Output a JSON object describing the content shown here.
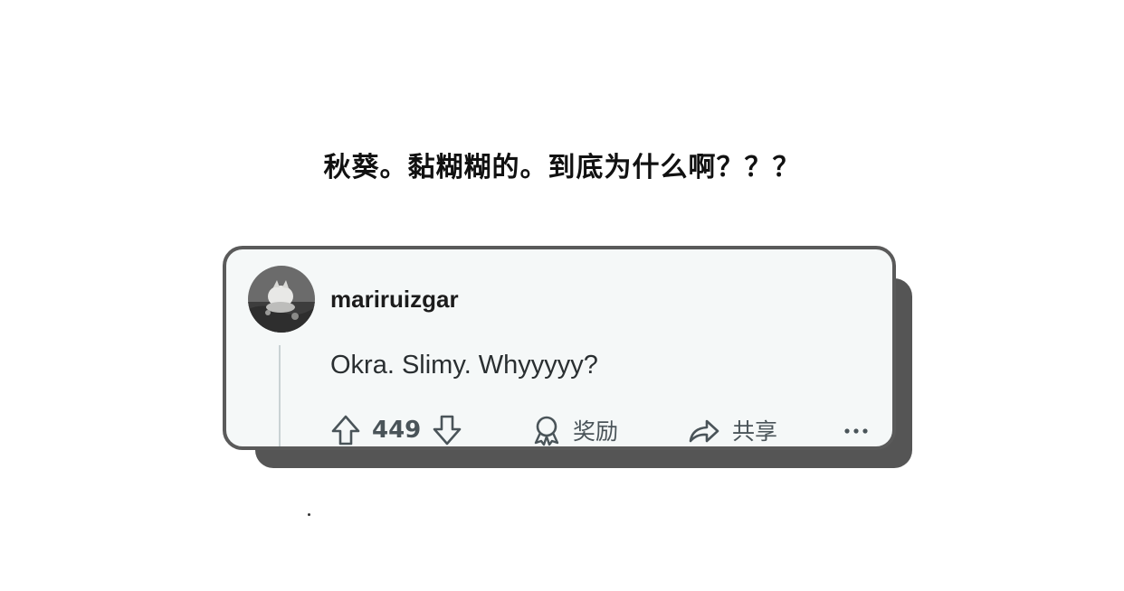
{
  "caption": "秋葵。黏糊糊的。到底为什么啊？？？",
  "comment": {
    "username": "mariruizgar",
    "text": "Okra. Slimy. Whyyyyy?",
    "score": "449",
    "award_label": "奖励",
    "share_label": "共享",
    "more_label": "···"
  },
  "icons": {
    "upvote": "arrow-up-icon",
    "downvote": "arrow-down-icon",
    "award": "award-ribbon-icon",
    "share": "share-arrow-icon",
    "more": "ellipsis-icon"
  },
  "colors": {
    "card_bg": "#f5f8f8",
    "card_border": "#5a5a5a",
    "card_shadow": "#555555",
    "action_text": "#4a5459"
  }
}
